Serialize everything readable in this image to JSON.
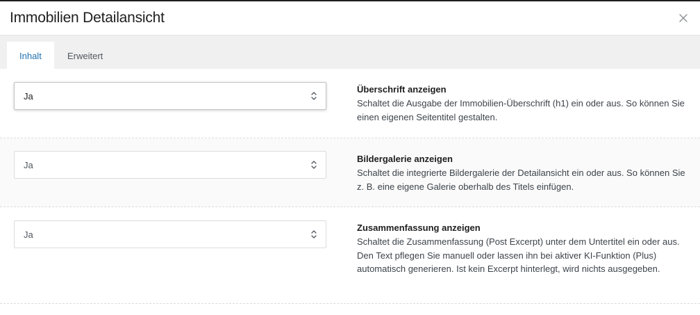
{
  "modal": {
    "title": "Immobilien Detailansicht",
    "close_icon": "close-icon"
  },
  "tabs": [
    {
      "label": "Inhalt",
      "active": true
    },
    {
      "label": "Erweitert",
      "active": false
    }
  ],
  "settings": [
    {
      "value": "Ja",
      "title": "Überschrift anzeigen",
      "description": "Schaltet die Ausgabe der Immobilien-Überschrift (h1) ein oder aus. So können Sie einen eigenen Seitentitel gestalten."
    },
    {
      "value": "Ja",
      "title": "Bildergalerie anzeigen",
      "description": "Schaltet die integrierte Bildergalerie der Detailansicht ein oder aus. So können Sie z. B. eine eigene Galerie oberhalb des Titels einfügen."
    },
    {
      "value": "Ja",
      "title": "Zusammenfassung anzeigen",
      "description": "Schaltet die Zusammenfassung (Post Excerpt) unter dem Untertitel ein oder aus. Den Text pflegen Sie manuell oder lassen ihn bei aktiver KI-Funktion (Plus) automatisch generieren. Ist kein Excerpt hinterlegt, wird nichts ausgegeben."
    }
  ],
  "colors": {
    "accent": "#2271b1",
    "tab_bar": "#f0f0f0"
  }
}
